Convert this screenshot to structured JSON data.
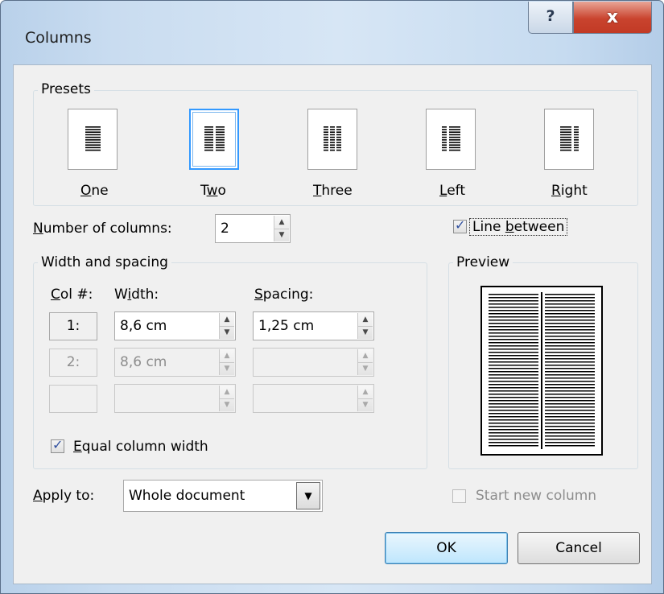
{
  "window": {
    "title": "Columns",
    "help_button": "?",
    "close_button": "x"
  },
  "presets": {
    "group_label": "Presets",
    "items": [
      {
        "label": "One",
        "accel_prefix": "",
        "accel": "O",
        "accel_suffix": "ne"
      },
      {
        "label": "Two",
        "accel_prefix": "T",
        "accel": "w",
        "accel_suffix": "o",
        "selected": true
      },
      {
        "label": "Three",
        "accel_prefix": "",
        "accel": "T",
        "accel_suffix": "hree"
      },
      {
        "label": "Left",
        "accel_prefix": "",
        "accel": "L",
        "accel_suffix": "eft"
      },
      {
        "label": "Right",
        "accel_prefix": "",
        "accel": "R",
        "accel_suffix": "ight"
      }
    ]
  },
  "number_of_columns": {
    "accel": "N",
    "label_rest": "umber of columns:",
    "value": "2"
  },
  "line_between": {
    "accel_prefix": "Line ",
    "accel": "b",
    "label_rest": "etween",
    "checked": true
  },
  "width_spacing": {
    "group_label": "Width and spacing",
    "col_header_accel": "C",
    "col_header_rest": "ol #:",
    "width_header_prefix": "W",
    "width_header_accel": "i",
    "width_header_rest": "dth:",
    "spacing_header_accel": "S",
    "spacing_header_rest": "pacing:",
    "rows": [
      {
        "col": "1:",
        "width": "8,6 cm",
        "spacing": "1,25 cm",
        "enabled": true
      },
      {
        "col": "2:",
        "width": "8,6 cm",
        "spacing": "",
        "enabled": false
      },
      {
        "col": "",
        "width": "",
        "spacing": "",
        "enabled": false
      }
    ],
    "equal_width_accel": "E",
    "equal_width_rest": "qual column width",
    "equal_width_checked": true
  },
  "preview": {
    "group_label": "Preview"
  },
  "apply_to": {
    "accel": "A",
    "label_rest": "pply to:",
    "value": "Whole document"
  },
  "start_new_column": {
    "label": "Start new column",
    "checked": false,
    "enabled": false
  },
  "buttons": {
    "ok": "OK",
    "cancel": "Cancel"
  },
  "icons": {
    "help": "question-mark-icon",
    "close": "close-x-icon",
    "spin_up": "spin-up-arrow-icon",
    "spin_down": "spin-down-arrow-icon",
    "dropdown": "dropdown-arrow-icon",
    "check": "checkmark-icon"
  }
}
